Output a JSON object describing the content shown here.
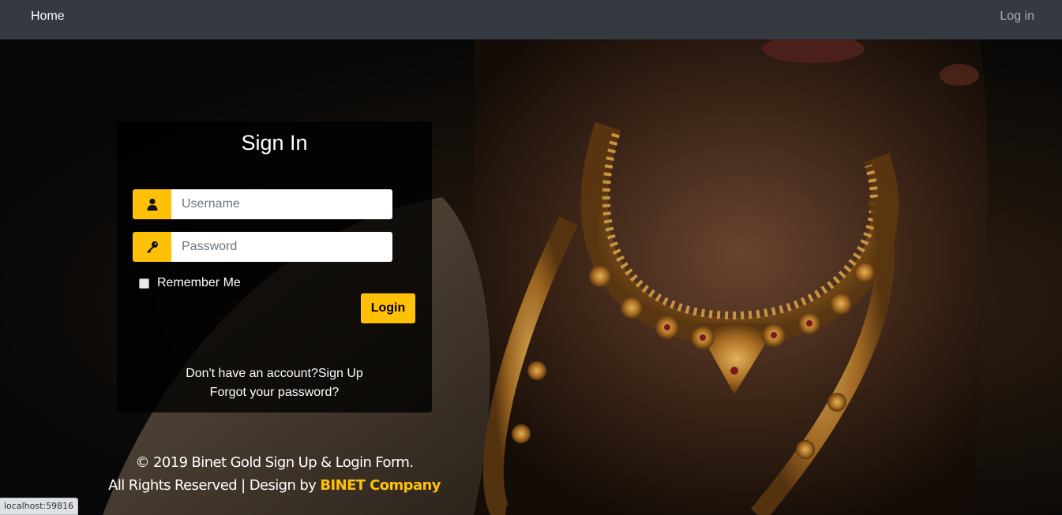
{
  "nav": {
    "home": "Home",
    "login": "Log in"
  },
  "form": {
    "title": "Sign In",
    "username_placeholder": "Username",
    "password_placeholder": "Password",
    "remember_label": "Remember Me",
    "login_button": "Login",
    "signup_prompt": "Don't have an account?",
    "signup_link": "Sign Up",
    "forgot_link": "Forgot your password?",
    "icons": {
      "username": "user-icon",
      "password": "key-icon"
    }
  },
  "footer": {
    "line1": "© 2019 Binet Gold Sign Up & Login Form.",
    "line2_prefix": "All Rights Reserved | Design by ",
    "brand": "BINET Company"
  },
  "status_bar": {
    "url": "localhost:59816"
  },
  "colors": {
    "navbar": "#343a40",
    "accent": "#ffc107"
  }
}
